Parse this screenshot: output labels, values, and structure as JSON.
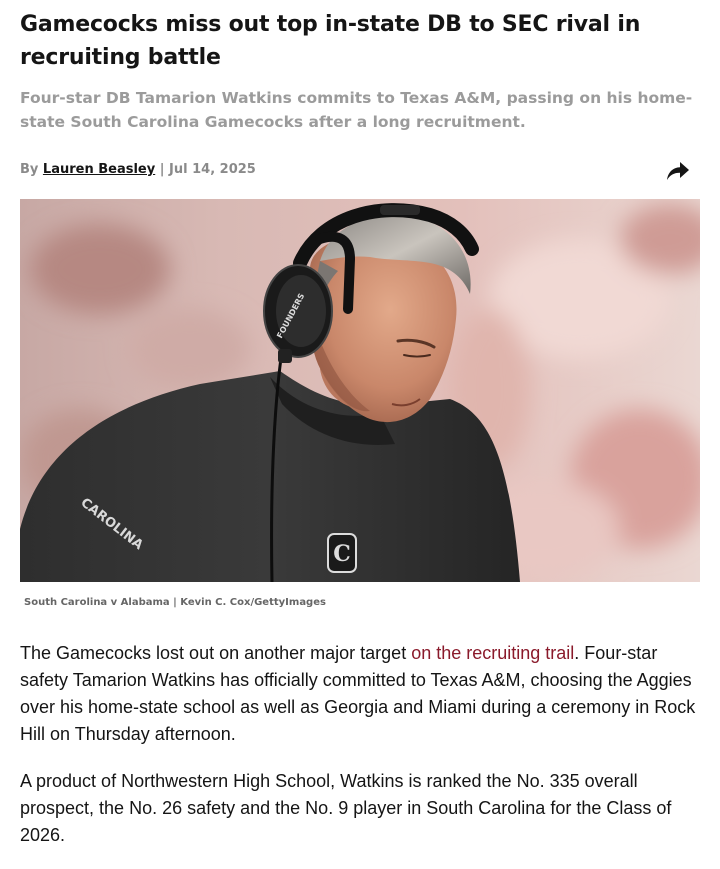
{
  "article": {
    "headline": "Gamecocks miss out top in-state DB to SEC rival in recruiting battle",
    "subheadline": "Four-star DB Tamarion Watkins commits to Texas A&M, passing on his home-state South Carolina Gamecocks after a long recruitment.",
    "byline": {
      "prefix": "By ",
      "author": "Lauren Beasley",
      "separator": " | ",
      "date": "Jul 14, 2025"
    },
    "share_icon": "share-arrow-icon",
    "photo": {
      "caption": "South Carolina v Alabama | Kevin C. Cox/GettyImages",
      "headset_text": "FOUNDERS",
      "shirt_text": "CAROLINA"
    },
    "paragraphs": [
      {
        "before_link": "The Gamecocks lost out on another major target ",
        "link_text": "on the recruiting trail",
        "after_link": ". Four-star safety Tamarion Watkins has officially committed to Texas A&M, choosing the Aggies over his home-state school as well as Georgia and Miami during a ceremony in Rock Hill on Thursday afternoon."
      },
      {
        "text": "A product of Northwestern High School, Watkins is ranked the No. 335 overall prospect, the No. 26 safety and the No. 9 player in South Carolina for the Class of 2026."
      }
    ]
  },
  "colors": {
    "link": "#8a1a2b",
    "subhead": "#9b9b9b",
    "byline_meta": "#8a8a8a",
    "headline": "#151515"
  }
}
